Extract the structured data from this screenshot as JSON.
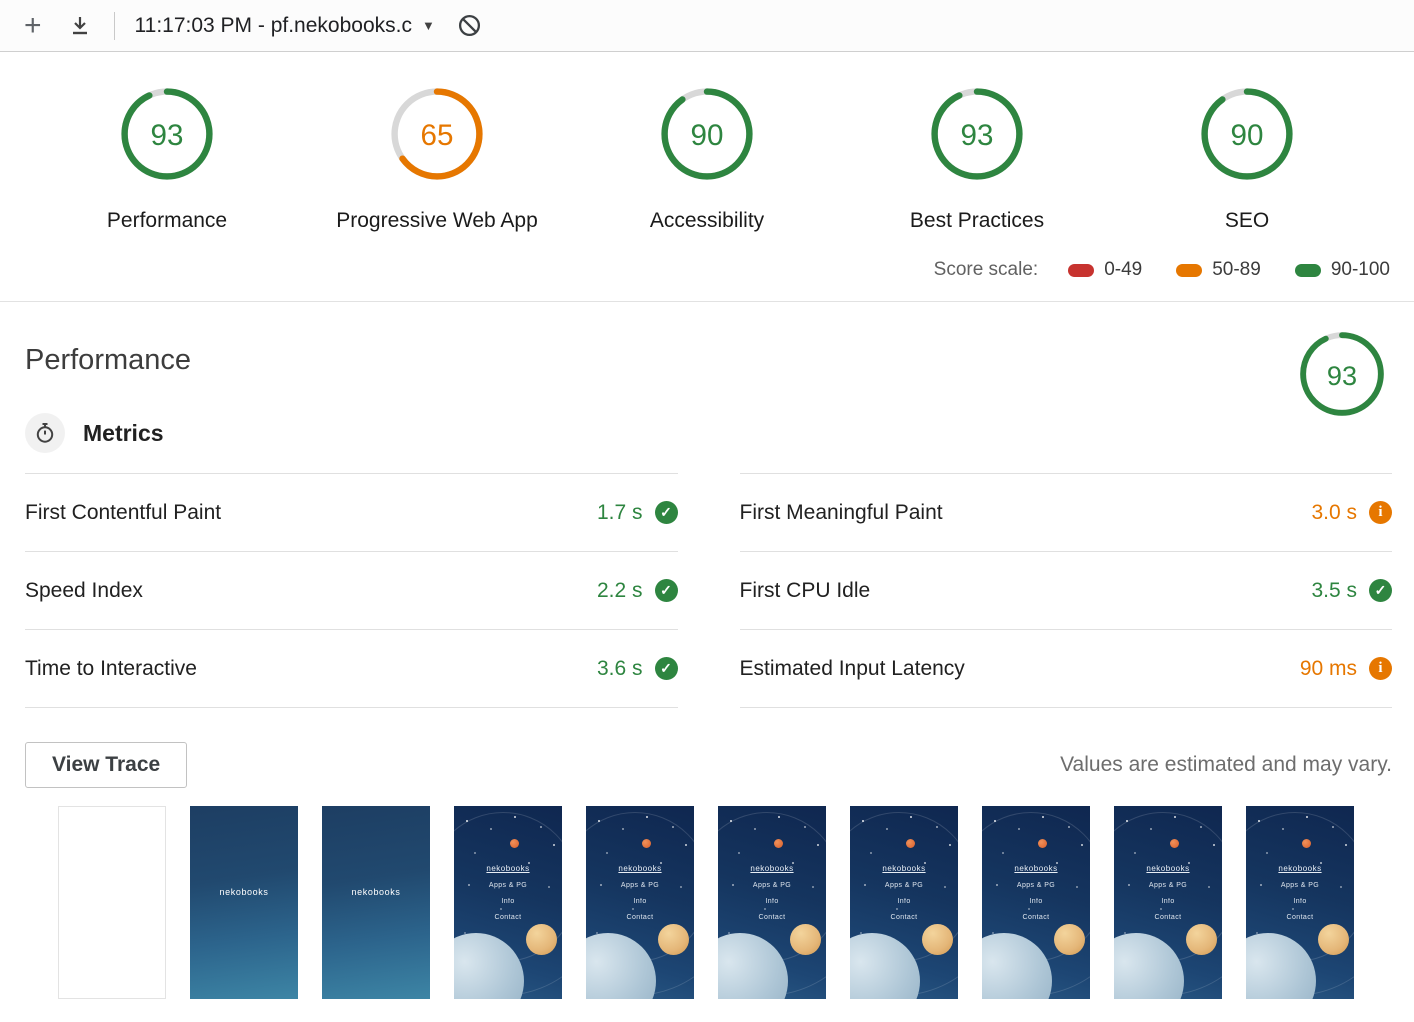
{
  "toolbar": {
    "new_audit_label": "+",
    "report_selector_label": "11:17:03 PM - pf.nekobooks.c",
    "caret": "▼"
  },
  "score_categories": [
    {
      "label": "Performance",
      "score": 93
    },
    {
      "label": "Progressive Web App",
      "score": 65
    },
    {
      "label": "Accessibility",
      "score": 90
    },
    {
      "label": "Best Practices",
      "score": 93
    },
    {
      "label": "SEO",
      "score": 90
    }
  ],
  "score_scale": {
    "label": "Score scale:",
    "ranges": [
      {
        "label": "0-49",
        "color": "#c7332f"
      },
      {
        "label": "50-89",
        "color": "#e67700"
      },
      {
        "label": "90-100",
        "color": "#2e8540"
      }
    ]
  },
  "performance_section": {
    "title": "Performance",
    "score": 93,
    "metrics_header": "Metrics",
    "metrics_left": [
      {
        "name": "First Contentful Paint",
        "value": "1.7 s",
        "status": "pass"
      },
      {
        "name": "Speed Index",
        "value": "2.2 s",
        "status": "pass"
      },
      {
        "name": "Time to Interactive",
        "value": "3.6 s",
        "status": "pass"
      }
    ],
    "metrics_right": [
      {
        "name": "First Meaningful Paint",
        "value": "3.0 s",
        "status": "average"
      },
      {
        "name": "First CPU Idle",
        "value": "3.5 s",
        "status": "pass"
      },
      {
        "name": "Estimated Input Latency",
        "value": "90 ms",
        "status": "average"
      }
    ],
    "view_trace_label": "View Trace",
    "disclaimer": "Values are estimated and may vary.",
    "filmstrip": {
      "splash_label": "nekobooks",
      "page_logo": "nekobooks",
      "page_menu": [
        "Apps & PG",
        "Info",
        "Contact"
      ],
      "frames": [
        "blank",
        "splash",
        "splash",
        "page",
        "page",
        "page",
        "page",
        "page",
        "page",
        "page"
      ]
    }
  }
}
